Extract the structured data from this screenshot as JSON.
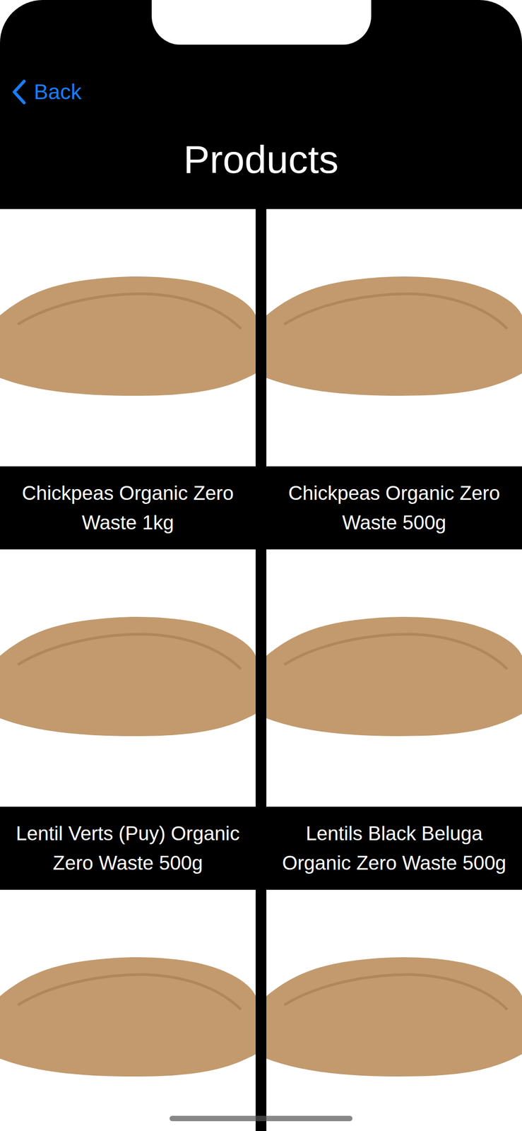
{
  "header": {
    "back": "Back",
    "title": "Products"
  },
  "products": [
    {
      "name": "Chickpeas Organic Zero Waste 1kg"
    },
    {
      "name": "Chickpeas Organic Zero Waste 500g"
    },
    {
      "name": "Lentil Verts (Puy) Organic Zero Waste 500g"
    },
    {
      "name": "Lentils Black Beluga Organic Zero Waste 500g"
    },
    {},
    {}
  ]
}
